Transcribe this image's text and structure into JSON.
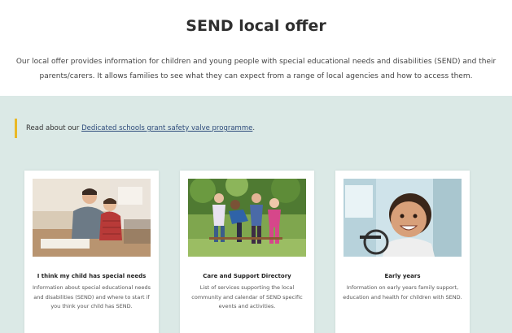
{
  "header": {
    "title": "SEND local offer",
    "intro": "Our local offer provides information for children and young people with special educational needs and disabilities (SEND) and their parents/carers. It allows families to see what they can expect from a range of local agencies and how to access them."
  },
  "notice": {
    "prefix": "Read about our ",
    "link": "Dedicated schools grant safety valve programme",
    "suffix": "."
  },
  "cards": [
    {
      "title": "I think my child has special needs",
      "description": "Information about special educational needs and disabilities (SEND) and where to start if you think your child has SEND.",
      "image": "parent-and-child-reading-image"
    },
    {
      "title": "Care and Support Directory",
      "description": "List of services supporting the local community and calendar of SEND specific events and activities.",
      "image": "children-playing-outdoors-image"
    },
    {
      "title": "Early years",
      "description": "Information on early years family support, education and health for children with SEND.",
      "image": "smiling-child-image"
    }
  ],
  "colors": {
    "band": "#dbe9e6",
    "accent_bar": "#e9b826",
    "link": "#2d4a7a"
  }
}
